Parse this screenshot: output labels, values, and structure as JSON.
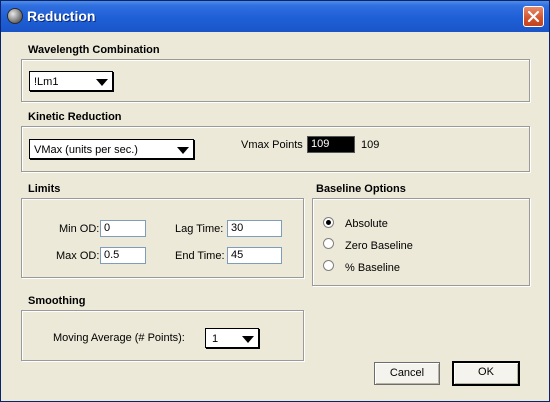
{
  "window": {
    "title": "Reduction"
  },
  "wavelength_combination": {
    "label": "Wavelength Combination",
    "selected": "!Lm1"
  },
  "kinetic_reduction": {
    "label": "Kinetic Reduction",
    "selected": "VMax (units per sec.)",
    "vmax_points_label": "Vmax Points",
    "vmax_points_value": "109",
    "vmax_points_readout": "109"
  },
  "limits": {
    "label": "Limits",
    "min_od_label": "Min OD:",
    "min_od_value": "0",
    "max_od_label": "Max OD:",
    "max_od_value": "0.5",
    "lag_time_label": "Lag Time:",
    "lag_time_value": "30",
    "end_time_label": "End Time:",
    "end_time_value": "45"
  },
  "baseline_options": {
    "label": "Baseline Options",
    "options": [
      {
        "label": "Absolute",
        "checked": true
      },
      {
        "label": "Zero Baseline",
        "checked": false
      },
      {
        "label": "% Baseline",
        "checked": false
      }
    ]
  },
  "smoothing": {
    "label": "Smoothing",
    "moving_average_label": "Moving Average (# Points):",
    "moving_average_value": "1"
  },
  "buttons": {
    "cancel": "Cancel",
    "ok": "OK"
  },
  "icons": {
    "title_icon": "globe-icon",
    "close_icon": "close-icon"
  }
}
